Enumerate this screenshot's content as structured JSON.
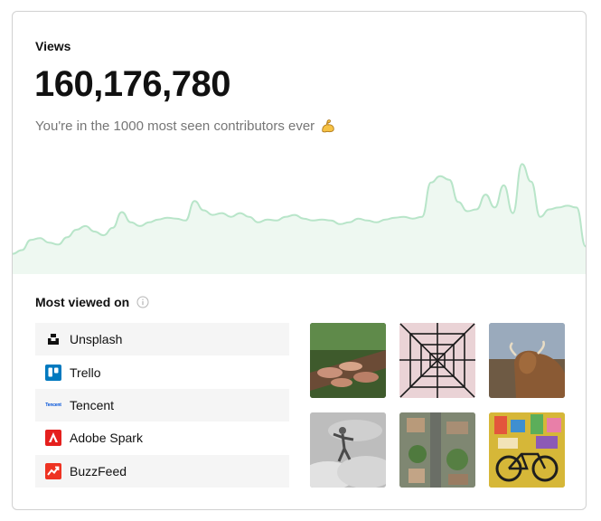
{
  "stats": {
    "label": "Views",
    "value": "160,176,780",
    "subtitle": "You're in the 1000 most seen contributors ever",
    "emoji_icon": "flexed-biceps-icon"
  },
  "chart_data": {
    "type": "area",
    "x": [
      0,
      1,
      2,
      3,
      4,
      5,
      6,
      7,
      8,
      9,
      10,
      11,
      12,
      13,
      14,
      15,
      16,
      17,
      18,
      19,
      20,
      21,
      22,
      23,
      24,
      25,
      26,
      27,
      28,
      29,
      30,
      31,
      32,
      33,
      34,
      35,
      36,
      37,
      38,
      39,
      40,
      41,
      42,
      43,
      44,
      45,
      46,
      47,
      48,
      49,
      50,
      51,
      52,
      53,
      54,
      55,
      56,
      57,
      58,
      59,
      60,
      61,
      62,
      63
    ],
    "values": [
      18,
      22,
      33,
      35,
      30,
      28,
      36,
      44,
      48,
      42,
      38,
      46,
      63,
      52,
      48,
      52,
      55,
      57,
      56,
      54,
      75,
      65,
      60,
      62,
      58,
      62,
      58,
      52,
      55,
      54,
      58,
      60,
      56,
      54,
      55,
      54,
      50,
      52,
      56,
      54,
      52,
      55,
      57,
      58,
      56,
      58,
      95,
      102,
      98,
      74,
      64,
      66,
      82,
      68,
      92,
      62,
      115,
      96,
      58,
      66,
      68,
      70,
      68,
      26
    ],
    "color": "#b8e5c9",
    "fill": "#eef8f1"
  },
  "most_viewed": {
    "title": "Most viewed on",
    "info_icon": "info-circle-icon",
    "platforms": [
      {
        "name": "Unsplash",
        "icon": "unsplash-logo-icon"
      },
      {
        "name": "Trello",
        "icon": "trello-logo-icon"
      },
      {
        "name": "Tencent",
        "icon": "tencent-logo-icon",
        "logo_text": "Tencent"
      },
      {
        "name": "Adobe Spark",
        "icon": "adobe-spark-logo-icon"
      },
      {
        "name": "BuzzFeed",
        "icon": "buzzfeed-logo-icon"
      }
    ],
    "thumbnails": [
      {
        "name": "hands-on-tree-photo"
      },
      {
        "name": "power-pylon-photo"
      },
      {
        "name": "highland-cow-photo"
      },
      {
        "name": "jumping-person-clouds-photo"
      },
      {
        "name": "aerial-city-photo"
      },
      {
        "name": "yellow-bicycle-photo"
      }
    ]
  }
}
